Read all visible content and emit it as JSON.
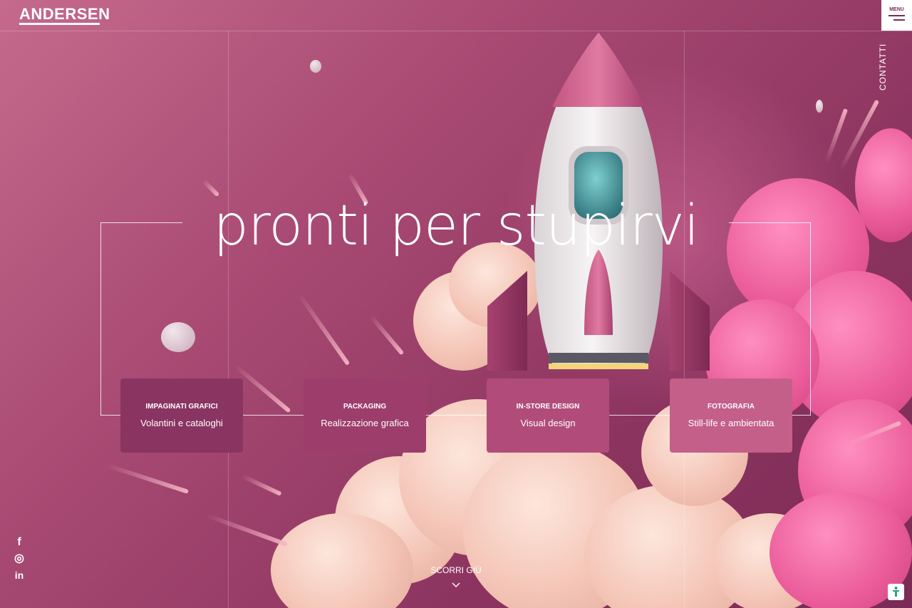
{
  "header": {
    "logo": "ANDERSEN",
    "menu_label": "MENU",
    "contact_label": "CONTATTI"
  },
  "hero": {
    "headline": "pronti per stupirvi"
  },
  "services": [
    {
      "title": "IMPAGINATI GRAFICI",
      "subtitle": "Volantini e cataloghi",
      "color": "#8a3462"
    },
    {
      "title": "PACKAGING",
      "subtitle": "Realizzazione grafica",
      "color": "#9c3d6c"
    },
    {
      "title": "IN-STORE DESIGN",
      "subtitle": "Visual design",
      "color": "#b14c7a"
    },
    {
      "title": "FOTOGRAFIA",
      "subtitle": "Still-life e ambientata",
      "color": "#c35f88"
    }
  ],
  "social": [
    {
      "icon": "facebook-icon",
      "glyph": "f"
    },
    {
      "icon": "instagram-icon",
      "glyph": "◎"
    },
    {
      "icon": "linkedin-icon",
      "glyph": "in"
    }
  ],
  "scroll": {
    "label": "SCORRI GIÙ"
  },
  "colors": {
    "brand": "#7a2b55",
    "background": "#a84a73"
  }
}
